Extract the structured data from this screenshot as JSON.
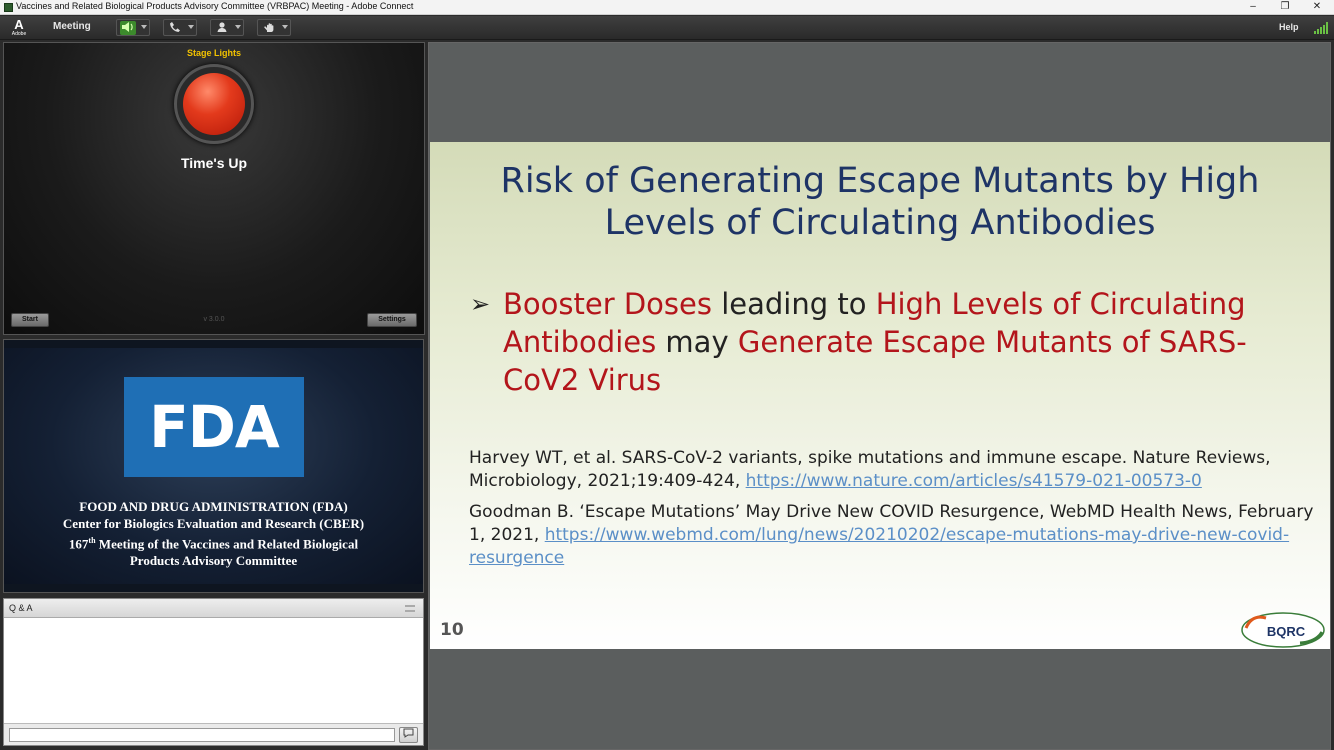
{
  "window": {
    "title": "Vaccines and Related Biological Products Advisory Committee (VRBPAC) Meeting - Adobe Connect",
    "minimize_glyph": "–",
    "restore_glyph": "❐",
    "close_glyph": "✕"
  },
  "menubar": {
    "logo_letter": "A",
    "logo_text": "Adobe",
    "meeting": "Meeting",
    "help": "Help",
    "icons": [
      "speaker-icon",
      "phone-icon",
      "user-icon",
      "raise-hand-icon",
      "signal-icon"
    ]
  },
  "stage_lights": {
    "label": "Stage Lights",
    "status": "Time's Up",
    "start": "Start",
    "settings": "Settings",
    "version": "v 3.0.0"
  },
  "fda_pod": {
    "logo_text": "FDA",
    "line1": "FOOD AND DRUG ADMINISTRATION (FDA)",
    "line2": "Center for Biologics Evaluation and Research (CBER)",
    "line3_num": "167",
    "line3_sup": "th",
    "line3_rest": " Meeting of the Vaccines and Related Biological",
    "line4": "Products Advisory Committee"
  },
  "qa": {
    "title": "Q & A",
    "input_value": ""
  },
  "slide": {
    "title": "Risk of Generating Escape Mutants by High Levels of Circulating Antibodies",
    "bullet_parts": [
      {
        "text": "Booster Doses",
        "red": true
      },
      {
        "text": " leading to ",
        "red": false
      },
      {
        "text": "High Levels of Circulating Antibodies",
        "red": true
      },
      {
        "text": " may ",
        "red": false
      },
      {
        "text": "Generate Escape Mutants of SARS-CoV2 Virus",
        "red": true
      }
    ],
    "ref1_text": "Harvey WT, et al. SARS-CoV-2 variants, spike mutations and immune escape. Nature Reviews, Microbiology, 2021;19:409-424, ",
    "ref1_link": "https://www.nature.com/articles/s41579-021-00573-0",
    "ref2_text": "Goodman B. ‘Escape Mutations’ May Drive New COVID Resurgence, WebMD Health News, February 1, 2021, ",
    "ref2_link": "https://www.webmd.com/lung/news/20210202/escape-mutations-may-drive-new-covid-resurgence",
    "page_number": "10",
    "logo_text": "BQRC"
  },
  "colors": {
    "slide_title": "#1e3466",
    "highlight_red": "#b3151b",
    "link": "#5b8fc7",
    "fda_blue": "#1f6fb5",
    "stage_label": "#f2c200"
  }
}
